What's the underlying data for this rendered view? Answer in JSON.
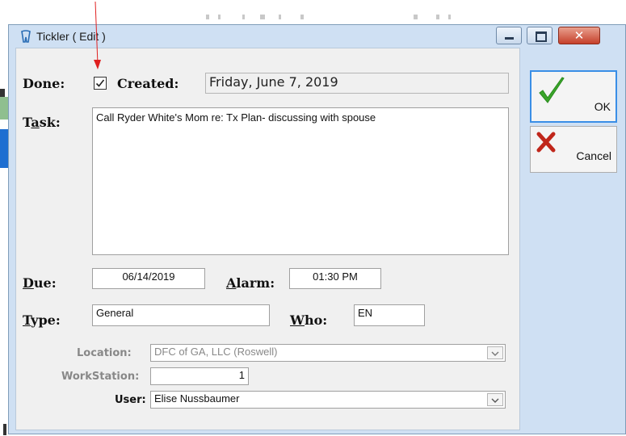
{
  "window": {
    "title": "Tickler ( Edit )"
  },
  "form": {
    "done_label": "Done:",
    "done_checked": true,
    "created_label": "Created:",
    "created_value": "Friday, June 7, 2019",
    "task_label_pre": "T",
    "task_label_u": "a",
    "task_label_post": "sk:",
    "task_value": "Call Ryder White's Mom re: Tx Plan- discussing with spouse",
    "due_label_u": "D",
    "due_label_post": "ue:",
    "due_value": "06/14/2019",
    "alarm_label_u": "A",
    "alarm_label_post": "larm:",
    "alarm_value": "01:30 PM",
    "type_label_u": "T",
    "type_label_post": "ype:",
    "type_value": "General",
    "who_label_u": "W",
    "who_label_post": "ho:",
    "who_value": "EN",
    "location_label": "Location:",
    "location_value": "DFC of GA, LLC (Roswell)",
    "workstation_label": "WorkStation:",
    "workstation_value": "1",
    "user_label": "User:",
    "user_value": "Elise Nussbaumer"
  },
  "buttons": {
    "ok_label": "OK",
    "cancel_label": "Cancel"
  },
  "icons": {
    "app": "tooth-icon",
    "ok": "green-checkmark-icon",
    "cancel": "red-x-icon",
    "minimize": "minimize-icon",
    "maximize": "maximize-icon",
    "close": "close-icon",
    "dropdown": "chevron-down-icon"
  },
  "colors": {
    "annotation_arrow": "#e02020",
    "ok_check": "#3aa52a",
    "cancel_x": "#c0261a",
    "title_bar": "#cfe0f3"
  }
}
